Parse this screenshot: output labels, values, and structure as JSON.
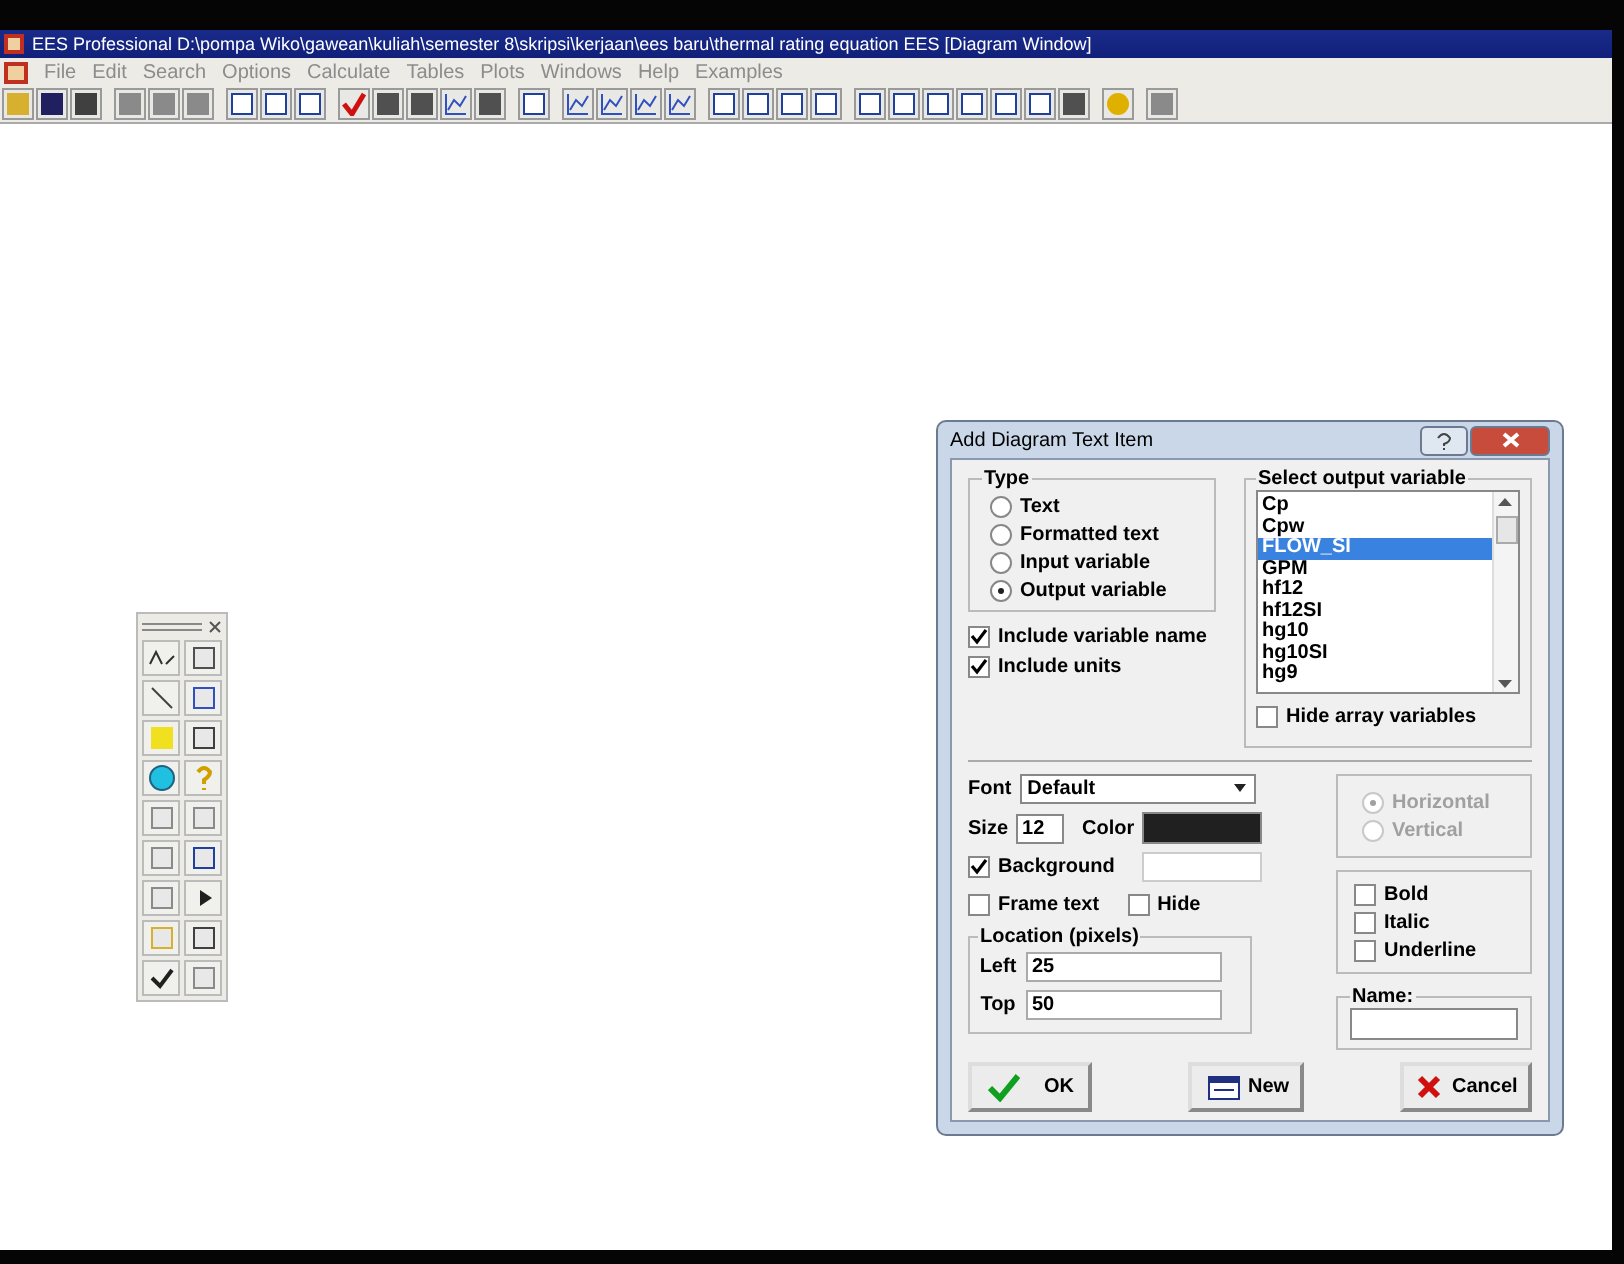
{
  "window": {
    "title": "EES Professional  D:\\pompa Wiko\\gawean\\kuliah\\semester 8\\skripsi\\kerjaan\\ees baru\\thermal rating equation EES   [Diagram Window]"
  },
  "menu": [
    "File",
    "Edit",
    "Search",
    "Options",
    "Calculate",
    "Tables",
    "Plots",
    "Windows",
    "Help",
    "Examples"
  ],
  "dialog": {
    "title": "Add Diagram Text Item",
    "type_group": {
      "label": "Type",
      "options": [
        {
          "label": "Text",
          "selected": false
        },
        {
          "label": "Formatted text",
          "selected": false
        },
        {
          "label": "Input variable",
          "selected": false
        },
        {
          "label": "Output variable",
          "selected": true
        }
      ]
    },
    "include": [
      {
        "label": "Include variable name",
        "checked": true
      },
      {
        "label": "Include units",
        "checked": true
      }
    ],
    "output_list": {
      "label": "Select output variable",
      "items": [
        {
          "label": "Cp",
          "selected": false
        },
        {
          "label": "Cpw",
          "selected": false
        },
        {
          "label": "FLOW_SI",
          "selected": true
        },
        {
          "label": "GPM",
          "selected": false
        },
        {
          "label": "hf12",
          "selected": false
        },
        {
          "label": "hf12SI",
          "selected": false
        },
        {
          "label": "hg10",
          "selected": false
        },
        {
          "label": "hg10SI",
          "selected": false
        },
        {
          "label": "hg9",
          "selected": false
        }
      ]
    },
    "hide_array": {
      "label": "Hide array variables",
      "checked": false
    },
    "font": {
      "label": "Font",
      "value": "Default"
    },
    "size": {
      "label": "Size",
      "value": "12"
    },
    "color": {
      "label": "Color",
      "color": "#202020"
    },
    "background": {
      "label": "Background",
      "checked": true
    },
    "frame_text": {
      "label": "Frame text",
      "checked": false
    },
    "hide": {
      "label": "Hide",
      "checked": false
    },
    "location": {
      "label": "Location (pixels)",
      "fields": [
        {
          "label": "Left",
          "value": "25"
        },
        {
          "label": "Top",
          "value": "50"
        }
      ]
    },
    "orientation": [
      {
        "label": "Horizontal",
        "selected": true,
        "disabled": true
      },
      {
        "label": "Vertical",
        "selected": false,
        "disabled": true
      }
    ],
    "styles": [
      {
        "label": "Bold",
        "checked": false
      },
      {
        "label": "Italic",
        "checked": false
      },
      {
        "label": "Underline",
        "checked": false
      }
    ],
    "name": {
      "label": "Name:"
    },
    "buttons": [
      {
        "label": "OK",
        "kind": "ok"
      },
      {
        "label": "New",
        "kind": "new"
      },
      {
        "label": "Cancel",
        "kind": "cancel"
      }
    ]
  }
}
